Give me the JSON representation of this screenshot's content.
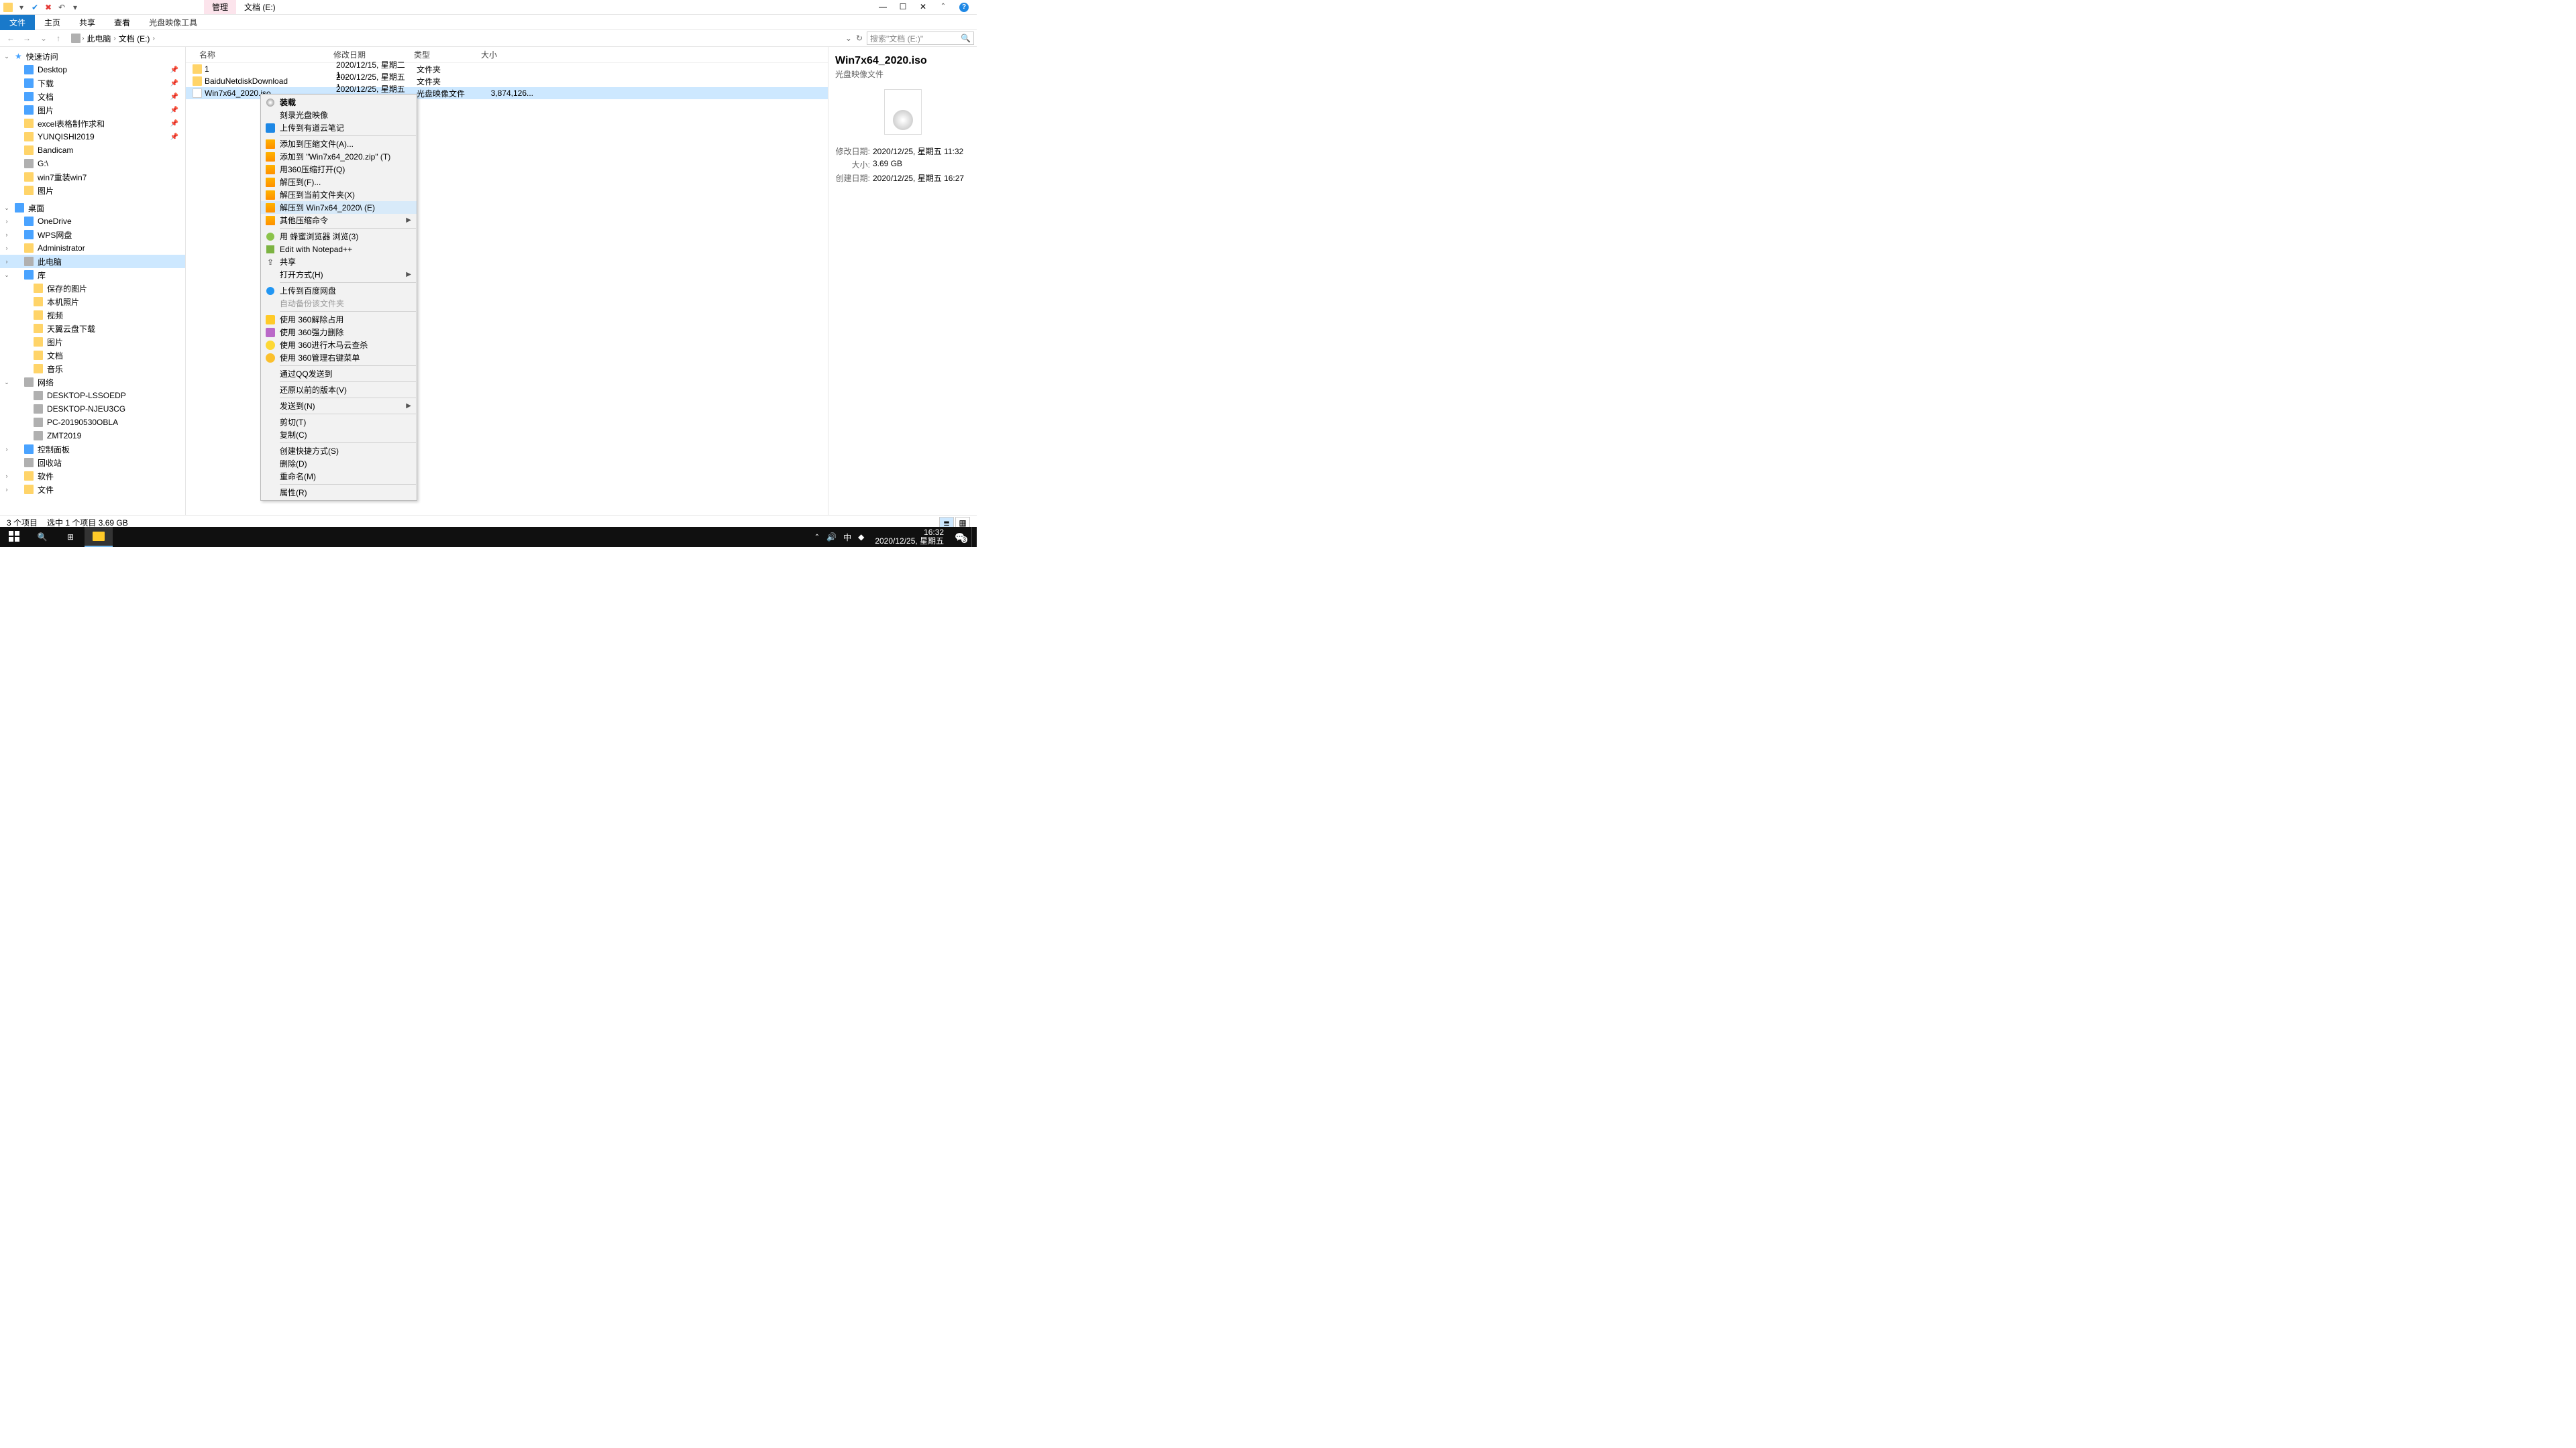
{
  "titlebar": {
    "ribbon_context_tab": "管理",
    "window_title": "文档 (E:)"
  },
  "ribbon": {
    "tabs": [
      "文件",
      "主页",
      "共享",
      "查看",
      "光盘映像工具"
    ]
  },
  "breadcrumb": {
    "root": "此电脑",
    "seg1": "文档 (E:)"
  },
  "search": {
    "placeholder": "搜索\"文档 (E:)\""
  },
  "nav": {
    "quick": {
      "label": "快速访问"
    },
    "quick_items": [
      {
        "label": "Desktop"
      },
      {
        "label": "下载"
      },
      {
        "label": "文档"
      },
      {
        "label": "图片"
      },
      {
        "label": "excel表格制作求和"
      },
      {
        "label": "YUNQISHI2019"
      },
      {
        "label": "Bandicam"
      },
      {
        "label": "G:\\"
      },
      {
        "label": "win7重装win7"
      },
      {
        "label": "图片"
      }
    ],
    "desktop": {
      "label": "桌面"
    },
    "desktop_items": [
      {
        "label": "OneDrive"
      },
      {
        "label": "WPS网盘"
      },
      {
        "label": "Administrator"
      },
      {
        "label": "此电脑"
      },
      {
        "label": "库"
      },
      {
        "label": "保存的图片"
      },
      {
        "label": "本机照片"
      },
      {
        "label": "视频"
      },
      {
        "label": "天翼云盘下载"
      },
      {
        "label": "图片"
      },
      {
        "label": "文档"
      },
      {
        "label": "音乐"
      },
      {
        "label": "网络"
      },
      {
        "label": "DESKTOP-LSSOEDP"
      },
      {
        "label": "DESKTOP-NJEU3CG"
      },
      {
        "label": "PC-20190530OBLA"
      },
      {
        "label": "ZMT2019"
      },
      {
        "label": "控制面板"
      },
      {
        "label": "回收站"
      },
      {
        "label": "软件"
      },
      {
        "label": "文件"
      }
    ]
  },
  "columns": {
    "name": "名称",
    "date": "修改日期",
    "type": "类型",
    "size": "大小"
  },
  "files": [
    {
      "name": "1",
      "date": "2020/12/15, 星期二 1...",
      "type": "文件夹",
      "size": ""
    },
    {
      "name": "BaiduNetdiskDownload",
      "date": "2020/12/25, 星期五 1...",
      "type": "文件夹",
      "size": ""
    },
    {
      "name": "Win7x64_2020.iso",
      "date": "2020/12/25, 星期五 1...",
      "type": "光盘映像文件",
      "size": "3,874,126..."
    }
  ],
  "ctx": {
    "mount": "装载",
    "burn": "刻录光盘映像",
    "youdao": "上传到有道云笔记",
    "add_archive": "添加到压缩文件(A)...",
    "add_zip": "添加到 \"Win7x64_2020.zip\" (T)",
    "open_360zip": "用360压缩打开(Q)",
    "extract_to": "解压到(F)...",
    "extract_here": "解压到当前文件夹(X)",
    "extract_named": "解压到 Win7x64_2020\\ (E)",
    "other_zip": "其他压缩命令",
    "bee": "用 蜂蜜浏览器 浏览(3)",
    "npp": "Edit with Notepad++",
    "share": "共享",
    "open_with": "打开方式(H)",
    "baidu": "上传到百度网盘",
    "autobackup": "自动备份该文件夹",
    "s360_unlock": "使用 360解除占用",
    "s360_del": "使用 360强力删除",
    "s360_trojan": "使用 360进行木马云查杀",
    "s360_menu": "使用 360管理右键菜单",
    "qq": "通过QQ发送到",
    "restore": "还原以前的版本(V)",
    "sendto": "发送到(N)",
    "cut": "剪切(T)",
    "copy": "复制(C)",
    "shortcut": "创建快捷方式(S)",
    "delete": "删除(D)",
    "rename": "重命名(M)",
    "props": "属性(R)"
  },
  "preview": {
    "title": "Win7x64_2020.iso",
    "subtitle": "光盘映像文件",
    "rows": [
      {
        "label": "修改日期:",
        "val": "2020/12/25, 星期五 11:32"
      },
      {
        "label": "大小:",
        "val": "3.69 GB"
      },
      {
        "label": "创建日期:",
        "val": "2020/12/25, 星期五 16:27"
      }
    ]
  },
  "status": {
    "items": "3 个项目",
    "selected": "选中 1 个项目  3.69 GB"
  },
  "taskbar": {
    "time": "16:32",
    "date": "2020/12/25, 星期五",
    "ime": "中",
    "badge": "3"
  }
}
